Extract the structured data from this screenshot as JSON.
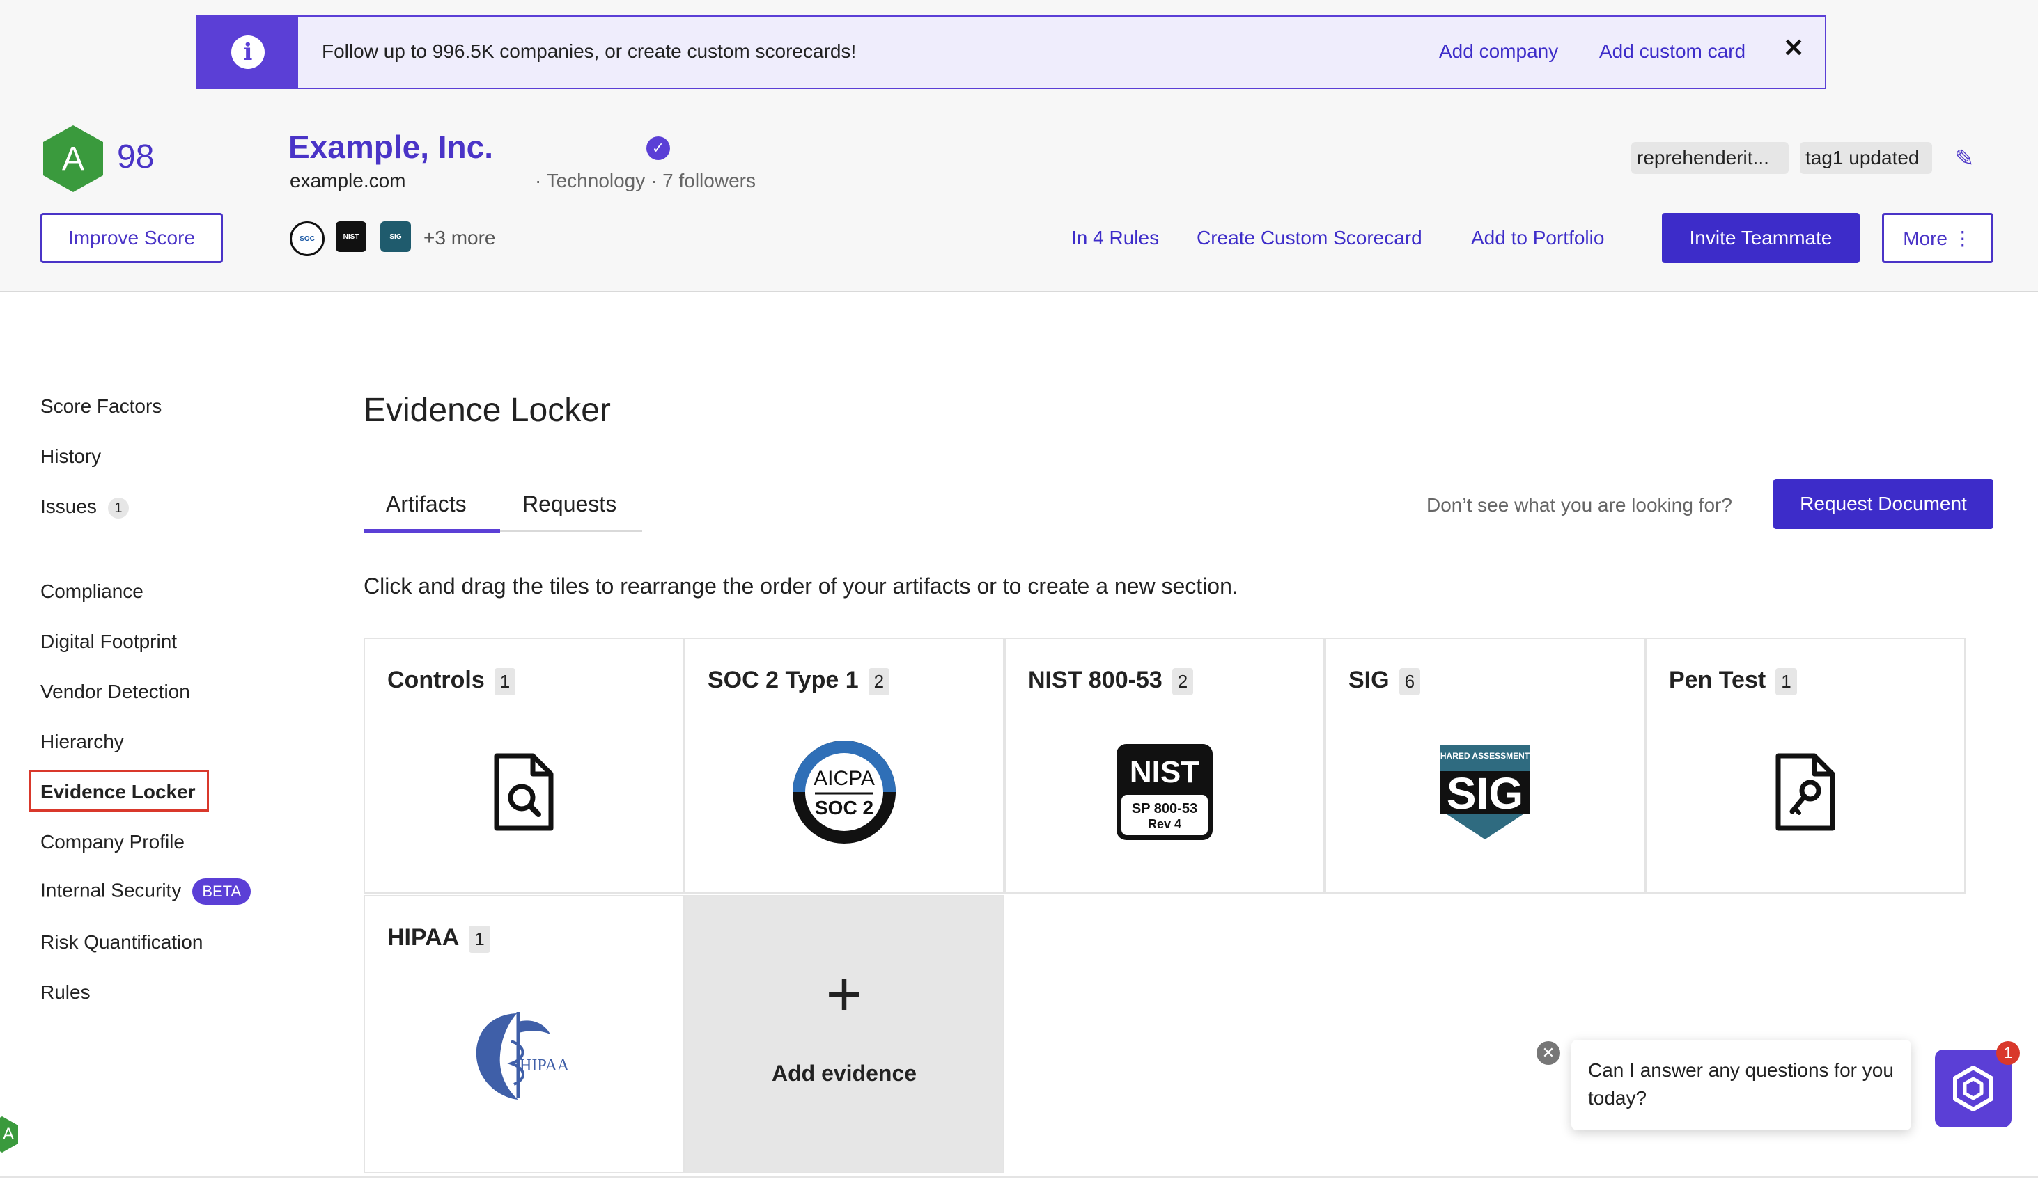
{
  "banner": {
    "text": "Follow up to 996.5K companies, or create custom scorecards!",
    "add_company": "Add company",
    "add_custom_card": "Add custom card",
    "close": "✕"
  },
  "header": {
    "grade": "A",
    "score": "98",
    "improve_score": "Improve Score",
    "company_name": "Example, Inc.",
    "domain": "example.com",
    "meta": "· Technology · 7 followers",
    "more_badges": "+3 more",
    "tags": [
      "reprehenderit...",
      "tag1 updated"
    ],
    "actions": {
      "in_rules": "In 4 Rules",
      "create_scorecard": "Create Custom Scorecard",
      "add_portfolio": "Add to Portfolio",
      "invite": "Invite Teammate",
      "more": "More ⋮"
    }
  },
  "sidebar": {
    "items": [
      {
        "label": "Score Factors"
      },
      {
        "label": "History"
      },
      {
        "label": "Issues",
        "count": "1"
      },
      {
        "label": "Compliance"
      },
      {
        "label": "Digital Footprint"
      },
      {
        "label": "Vendor Detection"
      },
      {
        "label": "Hierarchy"
      },
      {
        "label": "Evidence Locker"
      },
      {
        "label": "Company Profile"
      },
      {
        "label": "Internal Security",
        "badge": "BETA"
      },
      {
        "label": "Risk Quantification"
      },
      {
        "label": "Rules"
      }
    ]
  },
  "main": {
    "title": "Evidence Locker",
    "tabs": [
      {
        "label": "Artifacts"
      },
      {
        "label": "Requests"
      }
    ],
    "helper_text": "Don’t see what you are looking for?",
    "request_button": "Request Document",
    "instructions": "Click and drag the tiles to rearrange the order of your artifacts or to create a new section.",
    "tiles": [
      {
        "title": "Controls",
        "count": "1",
        "icon": "document-search-icon"
      },
      {
        "title": "SOC 2 Type 1",
        "count": "2",
        "icon": "aicpa-soc2-logo"
      },
      {
        "title": "NIST 800-53",
        "count": "2",
        "icon": "nist-logo"
      },
      {
        "title": "SIG",
        "count": "6",
        "icon": "sig-logo"
      },
      {
        "title": "Pen Test",
        "count": "1",
        "icon": "document-key-icon"
      },
      {
        "title": "HIPAA",
        "count": "1",
        "icon": "hipaa-logo"
      }
    ],
    "add_evidence": "Add evidence"
  },
  "logos": {
    "aicpa_top": "AICPA",
    "aicpa_bottom": "SOC 2",
    "nist_top": "NIST",
    "nist_line1": "SP 800-53",
    "nist_line2": "Rev 4",
    "sig_top": "SHARED ASSESSMENTS",
    "sig_main": "SIG",
    "hipaa": "HIPAA"
  },
  "chat": {
    "message": "Can I answer any questions for you today?",
    "unread": "1"
  },
  "colors": {
    "brand": "#5b3fd6",
    "brand_dark": "#3d2cc9",
    "grade_green": "#3a9a3d",
    "highlight_red": "#d9382b"
  }
}
